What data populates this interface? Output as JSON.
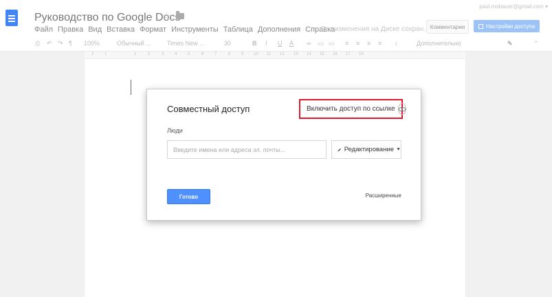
{
  "header": {
    "doc_title": "Руководство по Google Docs",
    "menu": [
      "Файл",
      "Правка",
      "Вид",
      "Вставка",
      "Формат",
      "Инструменты",
      "Таблица",
      "Дополнения",
      "Справка"
    ],
    "save_status": "Все изменения на Диске сохран...",
    "comments_label": "Комментарии",
    "share_label": "Настройки доступа",
    "account_email": "paul.mobauer@gmail.com ▾",
    "icons": {
      "app": "docs-icon",
      "star": "star-icon",
      "folder": "folder-icon"
    }
  },
  "toolbar": {
    "zoom": "100%",
    "style": "Обычный ...",
    "font": "Times New ...",
    "font_size": "30",
    "more": "Дополнительно"
  },
  "ruler": {
    "marks": [
      "2",
      "1",
      "1",
      "2",
      "3",
      "4",
      "5",
      "6",
      "7",
      "8",
      "9",
      "10",
      "11",
      "12",
      "13",
      "14",
      "15",
      "16",
      "17",
      "18"
    ]
  },
  "dialog": {
    "title": "Совместный доступ",
    "link_sharing_label": "Включить доступ по ссылке",
    "people_label": "Люди",
    "people_placeholder": "Введите имена или адреса эл. почты...",
    "permission": "Редактирование",
    "done_label": "Готово",
    "advanced_label": "Расширенные",
    "highlight_color": "#e2182a",
    "primary_color": "#4d90fe"
  }
}
